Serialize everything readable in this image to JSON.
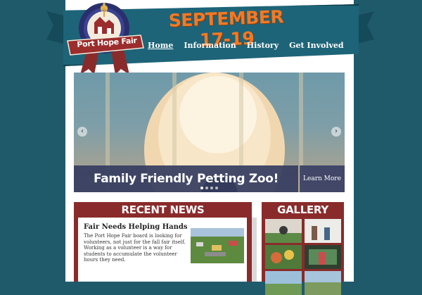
{
  "header": {
    "date": "SEPTEMBER 17-19",
    "logo_text": "Port Hope Fair",
    "nav": [
      {
        "label": "Home",
        "active": true
      },
      {
        "label": "Information",
        "active": false
      },
      {
        "label": "History",
        "active": false
      },
      {
        "label": "Get Involved",
        "active": false
      }
    ]
  },
  "slider": {
    "caption": "Family Friendly Petting Zoo!",
    "button": "Learn More",
    "prev_icon": "chevron-left-icon",
    "next_icon": "chevron-right-icon",
    "prev_glyph": "‹",
    "next_glyph": "›",
    "slide_count": 4,
    "active_slide": 1
  },
  "news": {
    "title": "RECENT NEWS",
    "article_title": "Fair Needs Helping Hands",
    "article_body": "The Port Hope Fair board is looking for volunteers, not just for the fall fair itself. Working as a volunteer is a way for students to accumulate the volunteer hours they need."
  },
  "gallery": {
    "title": "GALLERY"
  },
  "colors": {
    "background": "#1f5a6b",
    "ribbon": "#1d6478",
    "date": "#f07a27",
    "panel": "#8a2b2b",
    "caption": "#343c60"
  }
}
